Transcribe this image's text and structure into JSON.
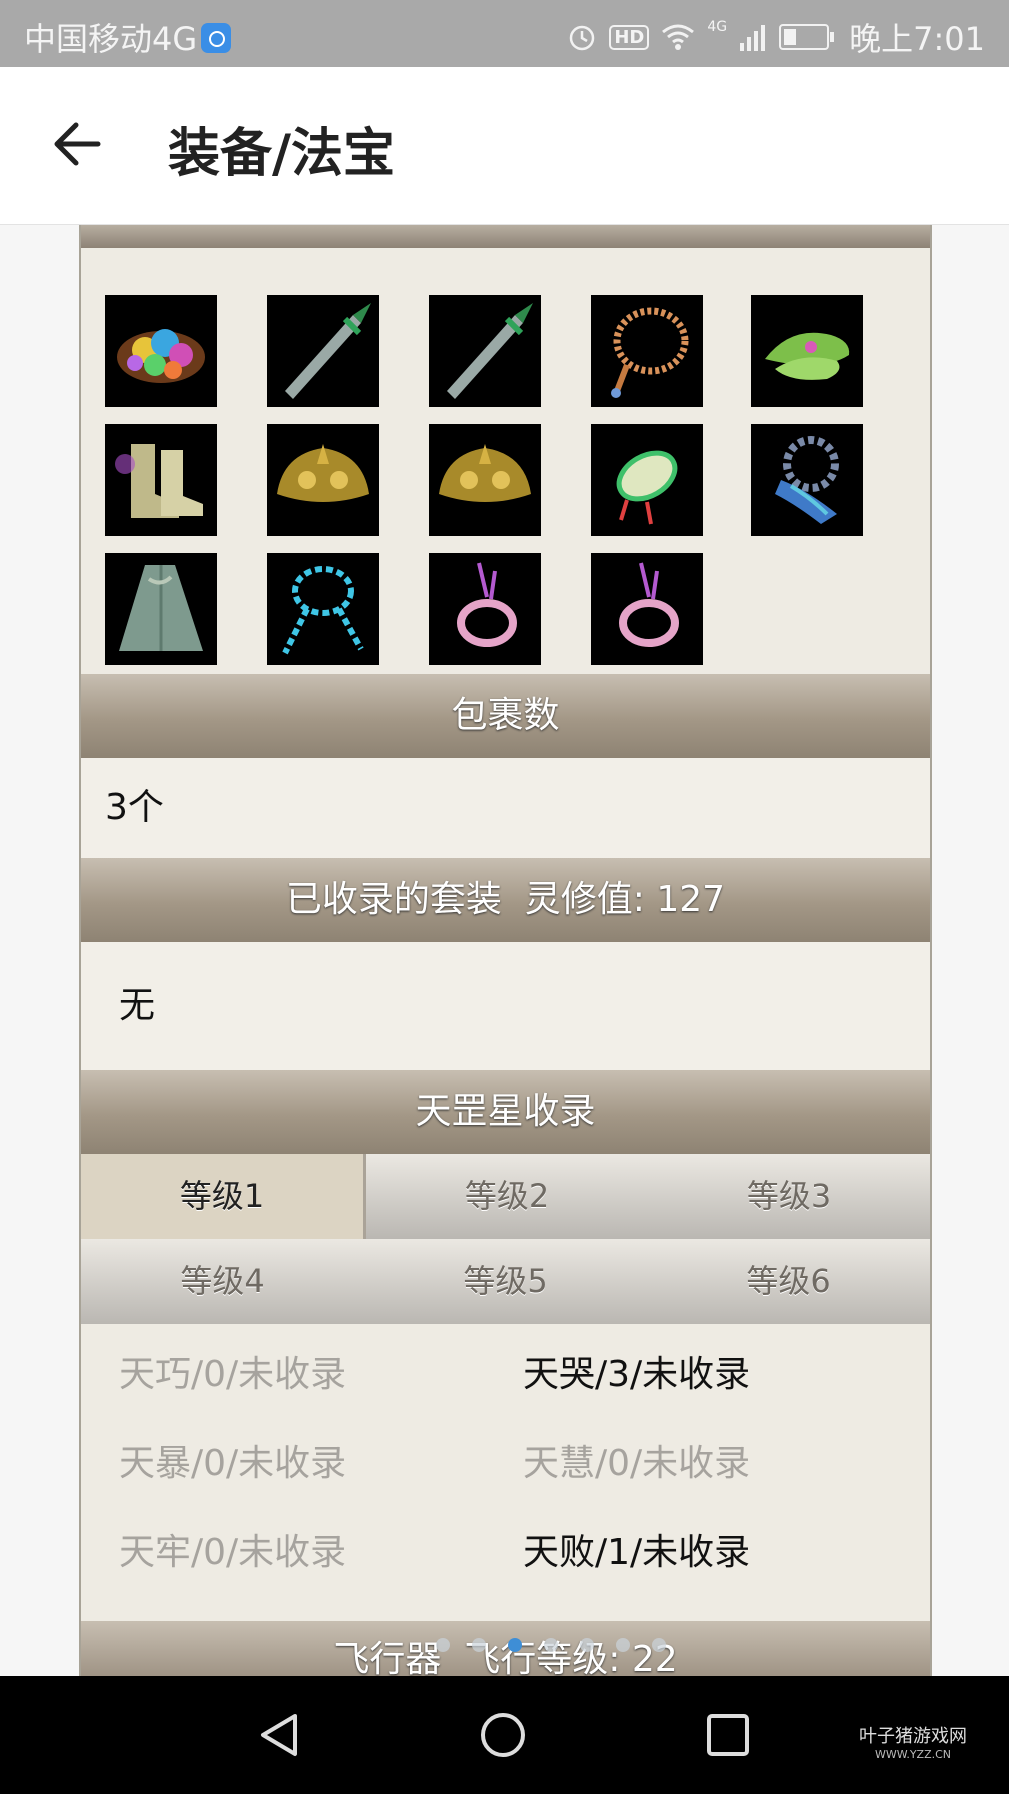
{
  "status_bar": {
    "carrier": "中国移动4G",
    "hd": "HD",
    "network": "4G",
    "time": "晚上7:01"
  },
  "header": {
    "title": "装备/法宝",
    "back_icon": "arrow-left-icon"
  },
  "equipment": {
    "items": [
      {
        "icon": "gem-cluster-icon"
      },
      {
        "icon": "jade-sword-icon"
      },
      {
        "icon": "jade-sword-icon"
      },
      {
        "icon": "bead-necklace-icon"
      },
      {
        "icon": "jade-shoes-icon"
      },
      {
        "icon": "boots-icon"
      },
      {
        "icon": "golden-helmet-icon"
      },
      {
        "icon": "golden-helmet-icon"
      },
      {
        "icon": "jade-pendant-icon"
      },
      {
        "icon": "gear-talisman-icon"
      },
      {
        "icon": "robe-icon"
      },
      {
        "icon": "ice-necklace-icon"
      },
      {
        "icon": "pink-ring-icon"
      },
      {
        "icon": "pink-ring-icon"
      }
    ]
  },
  "package": {
    "heading": "包裹数",
    "value": "3个"
  },
  "suits": {
    "heading": "已收录的套装  灵修值: 127",
    "value": "无"
  },
  "tiangang": {
    "heading": "天罡星收录",
    "tabs_row1": [
      "等级1",
      "等级2",
      "等级3"
    ],
    "tabs_row2": [
      "等级4",
      "等级5",
      "等级6"
    ],
    "active_tab": "等级1",
    "records": [
      [
        {
          "text": "天巧/0/未收录",
          "state": "muted"
        },
        {
          "text": "天哭/3/未收录",
          "state": "dark"
        }
      ],
      [
        {
          "text": "天暴/0/未收录",
          "state": "muted"
        },
        {
          "text": "天慧/0/未收录",
          "state": "muted"
        }
      ],
      [
        {
          "text": "天牢/0/未收录",
          "state": "muted"
        },
        {
          "text": "天败/1/未收录",
          "state": "dark"
        }
      ]
    ]
  },
  "flyer": {
    "heading": "飞行器  飞行等级: 22"
  },
  "page_indicator": {
    "count": 7,
    "active": 2
  },
  "watermark": {
    "line1": "叶子猪游戏网",
    "line2": "WWW.YZZ.CN"
  },
  "colors": {
    "accent_dot": "#3e8ed6",
    "section_bar": "#a39786",
    "panel_bg": "#eeebe3"
  }
}
